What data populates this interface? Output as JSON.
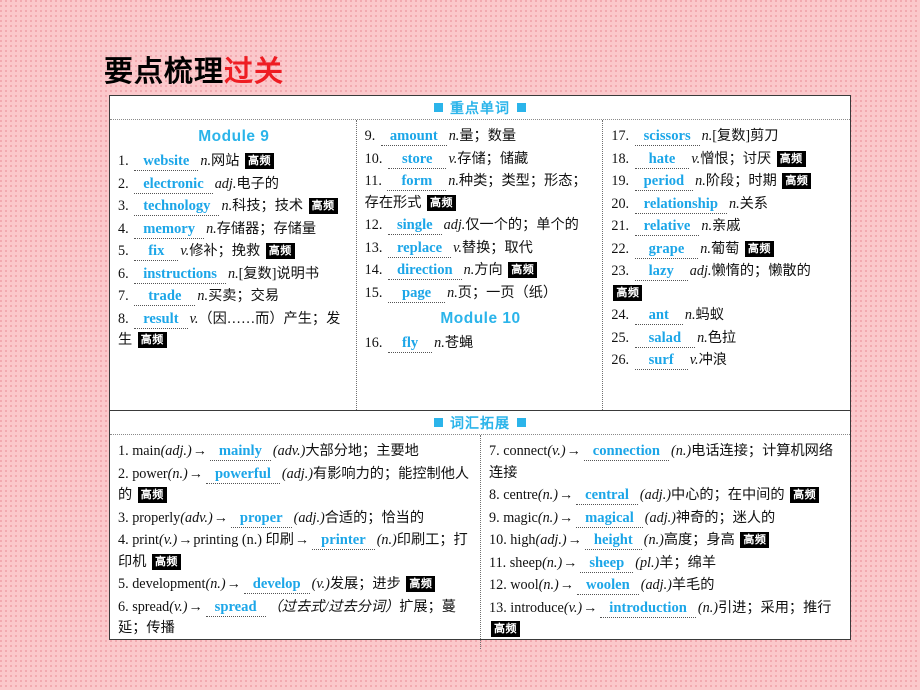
{
  "page": {
    "title_black": "要点梳理",
    "title_red": "过关"
  },
  "sections": [
    {
      "id": "key-words",
      "header": "重点单词",
      "bullet_color": "#2bb4ea"
    },
    {
      "id": "vocab-expansion",
      "header": "词汇拓展",
      "bullet_color": "#2bb4ea"
    }
  ],
  "modules": {
    "module9": "Module 9",
    "module10": "Module 10"
  },
  "badge_label": "高频",
  "arrow": "→",
  "key_words": {
    "column1": [
      {
        "num": "1.",
        "answer": "website",
        "pos": "n.",
        "meaning": "网站",
        "badge": true
      },
      {
        "num": "2.",
        "answer": "electronic",
        "pos": "adj.",
        "meaning": "电子的",
        "badge": false
      },
      {
        "num": "3.",
        "answer": "technology",
        "pos": "n.",
        "meaning": "科技；技术",
        "badge": true
      },
      {
        "num": "4.",
        "answer": "memory",
        "pos": "n.",
        "meaning": "存储器；存储量",
        "badge": false
      },
      {
        "num": "5.",
        "answer": "fix",
        "pos": "v.",
        "meaning": "修补；挽救",
        "badge": true
      },
      {
        "num": "6.",
        "answer": "instructions",
        "pos": "n.",
        "meaning": "[复数]说明书",
        "badge": false
      },
      {
        "num": "7.",
        "answer": "trade",
        "pos": "n.",
        "meaning": "买卖；交易",
        "badge": false
      },
      {
        "num": "8.",
        "answer": "result",
        "pos": "v.",
        "meaning": "（因……而）产生；发生",
        "badge": true
      }
    ],
    "column2": [
      {
        "num": "9.",
        "answer": "amount",
        "pos": "n.",
        "meaning": "量；数量",
        "badge": false
      },
      {
        "num": "10.",
        "answer": "store",
        "pos": "v.",
        "meaning": "存储；储藏",
        "badge": false
      },
      {
        "num": "11.",
        "answer": "form",
        "pos": "n.",
        "meaning": "种类；类型；形态；存在形式",
        "badge": true
      },
      {
        "num": "12.",
        "answer": "single",
        "pos": "adj.",
        "meaning": "仅一个的；单个的",
        "badge": false
      },
      {
        "num": "13.",
        "answer": "replace",
        "pos": "v.",
        "meaning": "替换；取代",
        "badge": false
      },
      {
        "num": "14.",
        "answer": "direction",
        "pos": "n.",
        "meaning": "方向",
        "badge": true
      },
      {
        "num": "15.",
        "answer": "page",
        "pos": "n.",
        "meaning": "页；一页（纸）",
        "badge": false
      }
    ],
    "column2_module10": [
      {
        "num": "16.",
        "answer": "fly",
        "pos": "n.",
        "meaning": "苍蝇",
        "badge": false
      }
    ],
    "column3": [
      {
        "num": "17.",
        "answer": "scissors",
        "pos": "n.",
        "meaning": "[复数]剪刀",
        "badge": false
      },
      {
        "num": "18.",
        "answer": "hate",
        "pos": "v.",
        "meaning": "憎恨；讨厌",
        "badge": true
      },
      {
        "num": "19.",
        "answer": "period",
        "pos": "n.",
        "meaning": "阶段；时期",
        "badge": true
      },
      {
        "num": "20.",
        "answer": "relationship",
        "pos": "n.",
        "meaning": "关系",
        "badge": false
      },
      {
        "num": "21.",
        "answer": "relative",
        "pos": "n.",
        "meaning": "亲戚",
        "badge": false
      },
      {
        "num": "22.",
        "answer": "grape",
        "pos": "n.",
        "meaning": "葡萄",
        "badge": true
      },
      {
        "num": "23.",
        "answer": "lazy",
        "pos": "adj.",
        "meaning": "懒惰的；懒散的",
        "badge": true
      },
      {
        "num": "24.",
        "answer": "ant",
        "pos": "n.",
        "meaning": "蚂蚁",
        "badge": false
      },
      {
        "num": "25.",
        "answer": "salad",
        "pos": "n.",
        "meaning": "色拉",
        "badge": false
      },
      {
        "num": "26.",
        "answer": "surf",
        "pos": "v.",
        "meaning": "冲浪",
        "badge": false
      }
    ]
  },
  "vocab_expansion": {
    "column_left": [
      {
        "num": "1.",
        "base": "main",
        "base_pos": "(adj.)",
        "answer": "mainly",
        "answer_pos": "(adv.)",
        "meaning": "大部分地；主要地",
        "badge": false
      },
      {
        "num": "2.",
        "base": "power",
        "base_pos": "(n.)",
        "answer": "powerful",
        "answer_pos": "(adj.)",
        "meaning": "有影响力的；能控制他人的",
        "badge": true
      },
      {
        "num": "3.",
        "base": "properly",
        "base_pos": "(adv.)",
        "answer": "proper",
        "answer_pos": "(adj.)",
        "meaning": "合适的；恰当的",
        "badge": false
      },
      {
        "num": "4.",
        "base": "print",
        "base_pos": "(v.)",
        "middle": "printing (n.) 印刷",
        "answer": "printer",
        "answer_pos": "(n.)",
        "meaning": "印刷工；打印机",
        "badge": true
      },
      {
        "num": "5.",
        "base": "development",
        "base_pos": "(n.)",
        "answer": "develop",
        "answer_pos": "(v.)",
        "meaning": "发展；进步",
        "badge": true
      },
      {
        "num": "6.",
        "base": "spread",
        "base_pos": "(v.)",
        "answer": "spread",
        "answer_pos": "（过去式/过去分词）",
        "meaning": "扩展；蔓延；传播",
        "badge": false
      }
    ],
    "column_right": [
      {
        "num": "7.",
        "base": "connect",
        "base_pos": "(v.)",
        "answer": "connection",
        "answer_pos": "(n.)",
        "meaning": "电话连接；计算机网络连接",
        "badge": false
      },
      {
        "num": "8.",
        "base": "centre",
        "base_pos": "(n.)",
        "answer": "central",
        "answer_pos": "(adj.)",
        "meaning": "中心的；在中间的",
        "badge": true
      },
      {
        "num": "9.",
        "base": "magic",
        "base_pos": "(n.)",
        "answer": "magical",
        "answer_pos": "(adj.)",
        "meaning": "神奇的；迷人的",
        "badge": false
      },
      {
        "num": "10.",
        "base": "high",
        "base_pos": "(adj.)",
        "answer": "height",
        "answer_pos": "(n.)",
        "meaning": "高度；身高",
        "badge": true
      },
      {
        "num": "11.",
        "base": "sheep",
        "base_pos": "(n.)",
        "answer": "sheep",
        "answer_pos": "(pl.)",
        "meaning": "羊；绵羊",
        "badge": false
      },
      {
        "num": "12.",
        "base": "wool",
        "base_pos": "(n.)",
        "answer": "woolen",
        "answer_pos": "(adj.)",
        "meaning": "羊毛的",
        "badge": false
      },
      {
        "num": "13.",
        "base": "introduce",
        "base_pos": "(v.)",
        "answer": "introduction",
        "answer_pos": "(n.)",
        "meaning": "引进；采用；推行",
        "badge": true
      }
    ]
  }
}
